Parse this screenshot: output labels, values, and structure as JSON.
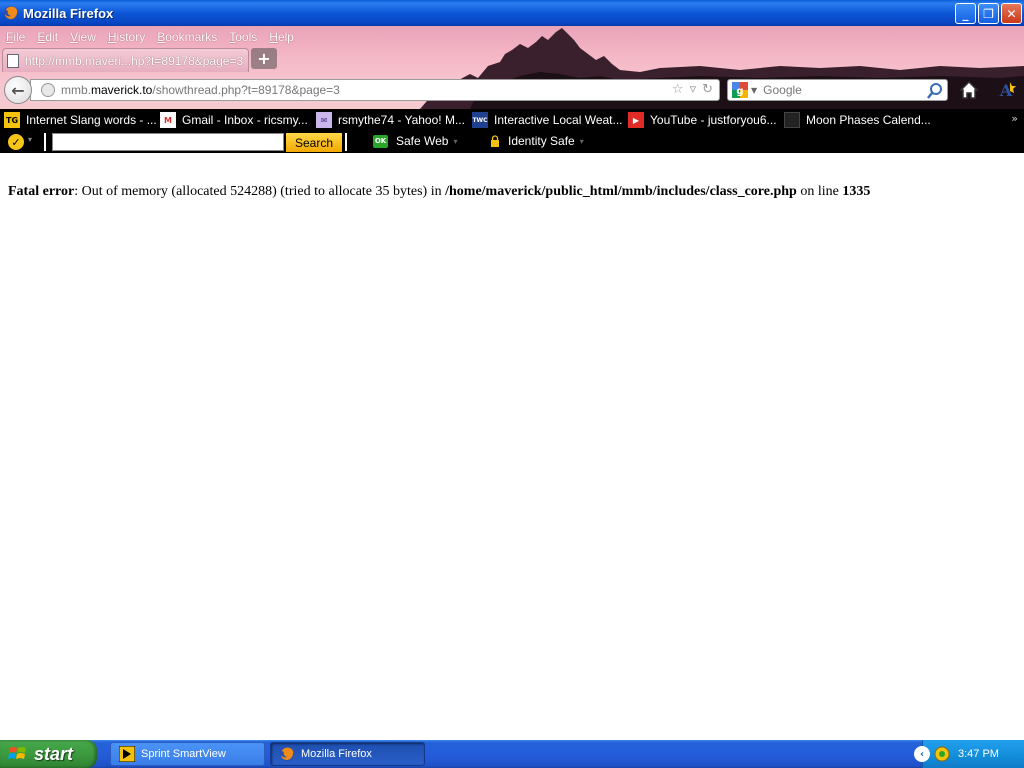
{
  "window": {
    "title": "Mozilla Firefox",
    "buttons": {
      "minimize": "_",
      "maximize": "❐",
      "close": "✕"
    }
  },
  "menubar": {
    "items": [
      {
        "label": "File"
      },
      {
        "label": "Edit"
      },
      {
        "label": "View"
      },
      {
        "label": "History"
      },
      {
        "label": "Bookmarks"
      },
      {
        "label": "Tools"
      },
      {
        "label": "Help"
      }
    ]
  },
  "tabs": {
    "active": {
      "label": "http://mmb.maveri...hp?t=89178&page=3"
    },
    "new_tab_label": "+"
  },
  "navbar": {
    "url_prefix": "mmb.",
    "url_host": "maverick.to",
    "url_path": "/showthread.php?t=89178&page=3",
    "search_placeholder": "Google"
  },
  "bookmarks": {
    "items": [
      {
        "label": "Internet Slang words - ...",
        "icon": "tg-icon",
        "color": "#f4c20d",
        "text": "TG"
      },
      {
        "label": "Gmail - Inbox - ricsmy...",
        "icon": "gmail-icon",
        "color": "#ffffff",
        "text": "M"
      },
      {
        "label": "rsmythe74 - Yahoo! M...",
        "icon": "envelope-icon",
        "color": "#c8b7e8",
        "text": "✉"
      },
      {
        "label": "Interactive Local Weat...",
        "icon": "twc-icon",
        "color": "#1f3f8f",
        "text": "TWC"
      },
      {
        "label": "YouTube - justforyou6...",
        "icon": "youtube-icon",
        "color": "#e12b26",
        "text": "▶"
      },
      {
        "label": "Moon Phases Calend...",
        "icon": "moon-icon",
        "color": "#222222",
        "text": ""
      }
    ],
    "overflow": "»"
  },
  "norton": {
    "search_button": "Search",
    "safe_web_label": "Safe Web",
    "ok_badge": "OK",
    "identity_safe_label": "Identity Safe",
    "dropdown_arrow": "▾"
  },
  "content": {
    "error_label": "Fatal error",
    "error_message": ": Out of memory (allocated 524288) (tried to allocate 35 bytes) in ",
    "error_path": "/home/maverick/public_html/mmb/includes/class_core.php",
    "error_online": " on line ",
    "error_line_number": "1335"
  },
  "taskbar": {
    "start_label": "start",
    "tasks": [
      {
        "label": "Sprint SmartView",
        "active": false
      },
      {
        "label": "Mozilla Firefox",
        "active": true
      }
    ],
    "clock": "3:47 PM"
  },
  "colors": {
    "titlebar_blue": "#0b56d6",
    "chrome_pink": "#f4b6c5",
    "toolbar_black": "#000000",
    "start_green": "#3c9a3f",
    "tray_blue": "#1590dc"
  }
}
